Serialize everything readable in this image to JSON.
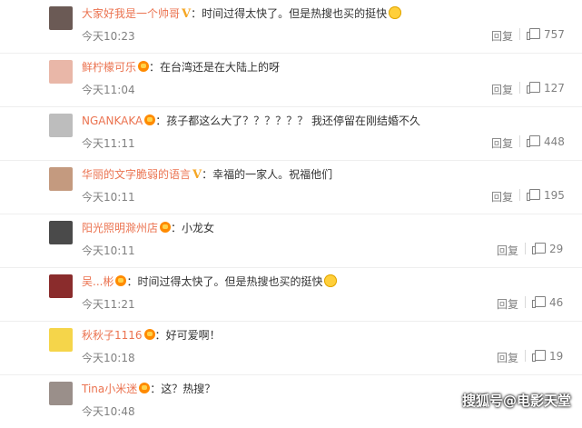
{
  "comments": [
    {
      "user": "大家好我是一个帅哥",
      "badge": "V",
      "text": "时间过得太快了。但是热搜也买的挺快",
      "emoji": true,
      "time": "今天10:23",
      "reply": "回复",
      "likes": "757",
      "avatar_color": "#6b5a55"
    },
    {
      "user": "鲜柠檬可乐",
      "badge": "vip",
      "text": "在台湾还是在大陆上的呀",
      "emoji": false,
      "time": "今天11:04",
      "reply": "回复",
      "likes": "127",
      "avatar_color": "#e9b7a8"
    },
    {
      "user": "NGANKAKA",
      "badge": "vip",
      "text": "孩子都这么大了？？？？？？ 我还停留在刚结婚不久",
      "emoji": false,
      "time": "今天11:11",
      "reply": "回复",
      "likes": "448",
      "avatar_color": "#bdbdbd"
    },
    {
      "user": "华丽的文字脆弱的语言",
      "badge": "V",
      "text": "幸福的一家人。祝福他们",
      "emoji": false,
      "time": "今天10:11",
      "reply": "回复",
      "likes": "195",
      "avatar_color": "#c49a7f"
    },
    {
      "user": "阳光照明滁州店",
      "badge": "vip",
      "text": "小龙女",
      "emoji": false,
      "time": "今天10:11",
      "reply": "回复",
      "likes": "29",
      "avatar_color": "#4a4a4a"
    },
    {
      "user": "吴...彬",
      "badge": "vip",
      "text": "时间过得太快了。但是热搜也买的挺快",
      "emoji": true,
      "time": "今天11:21",
      "reply": "回复",
      "likes": "46",
      "avatar_color": "#8a2c2c"
    },
    {
      "user": "秋秋子1116",
      "badge": "vip",
      "text": "好可爱啊！",
      "emoji": false,
      "time": "今天10:18",
      "reply": "回复",
      "likes": "19",
      "avatar_color": "#f5d54a"
    },
    {
      "user": "Tina小米迷",
      "badge": "vip",
      "text": "这？热搜？",
      "emoji": false,
      "time": "今天10:48",
      "reply": "",
      "likes": "",
      "avatar_color": "#9a8f8a"
    }
  ],
  "watermark": "搜狐号@电影天堂"
}
